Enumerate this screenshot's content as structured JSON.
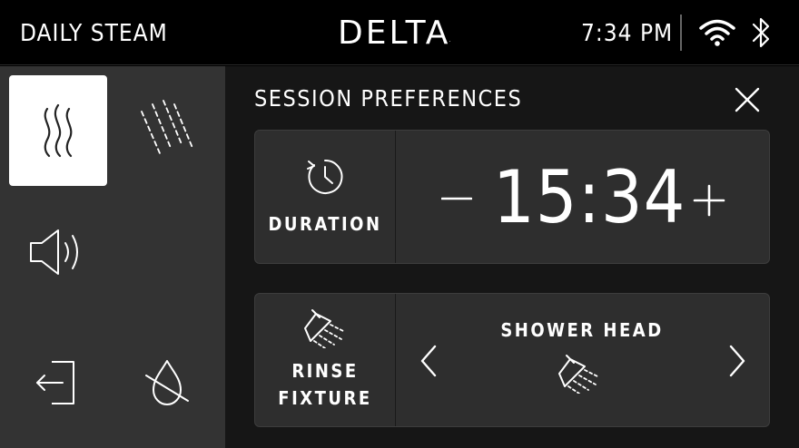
{
  "header": {
    "preset_name": "DAILY STEAM",
    "brand": "DELTA",
    "brand_mark": ".",
    "time": "7:34 PM",
    "icons": [
      "wifi-icon",
      "bluetooth-icon"
    ]
  },
  "sidebar": {
    "items": [
      {
        "name": "steam",
        "icon": "steam-icon",
        "active": true
      },
      {
        "name": "shower",
        "icon": "rain-icon",
        "active": false
      },
      {
        "name": "audio",
        "icon": "speaker-icon",
        "active": false
      },
      {
        "name": "exit",
        "icon": "exit-icon",
        "active": false
      },
      {
        "name": "water-off",
        "icon": "water-drop-off-icon",
        "active": false
      }
    ]
  },
  "panel": {
    "title": "SESSION PREFERENCES",
    "duration": {
      "label": "DURATION",
      "value": "15:34",
      "icon": "timer-icon"
    },
    "rinse_fixture": {
      "label_line1": "RINSE",
      "label_line2": "FIXTURE",
      "selected": "SHOWER HEAD",
      "icon": "shower-head-icon"
    }
  },
  "colors": {
    "background": "#000000",
    "sidebar": "#333333",
    "panel": "#161616",
    "card": "#2e2e2e",
    "active_tile": "#ffffff",
    "text": "#ffffff"
  }
}
